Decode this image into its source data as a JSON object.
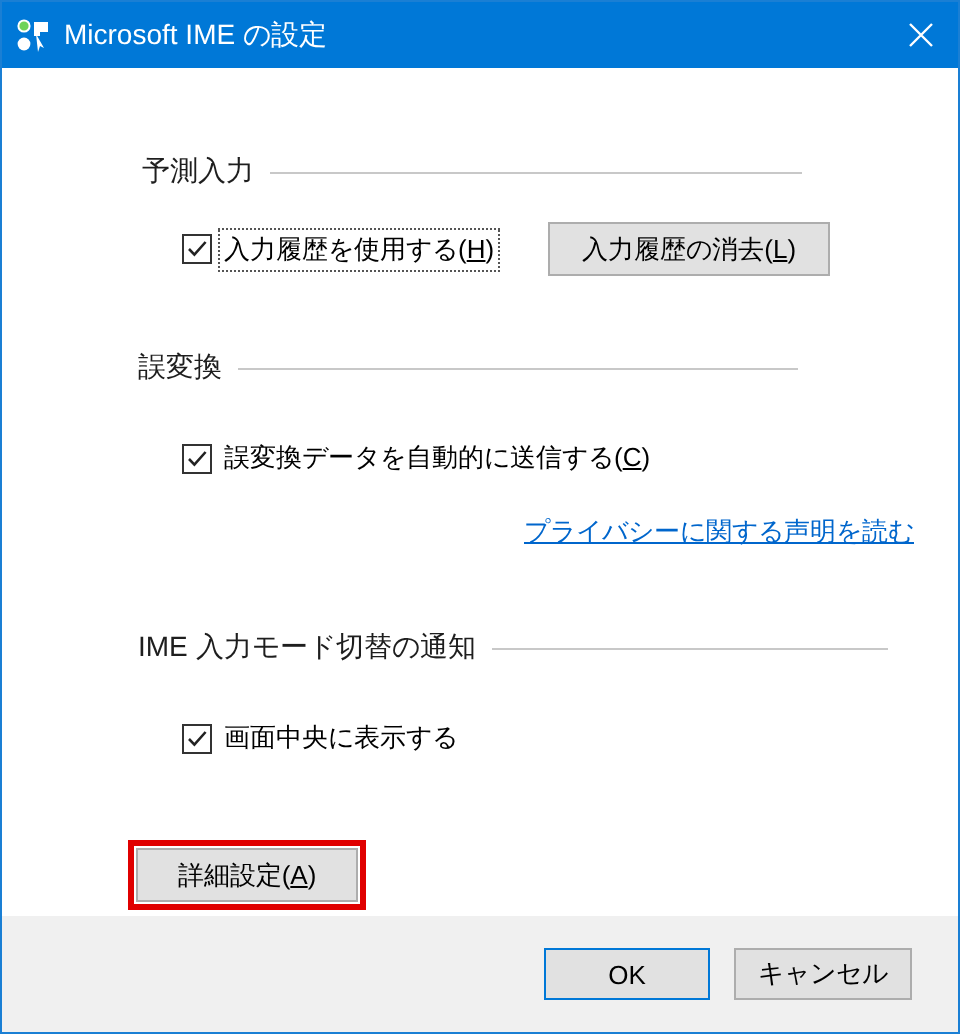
{
  "window": {
    "title": "Microsoft IME の設定"
  },
  "sections": [
    {
      "heading": "予測入力",
      "options": [
        {
          "kind": "checkbox",
          "label": "入力履歴を使用する(",
          "access_key": "H",
          "label_end": ")",
          "checked": true,
          "focused": true,
          "button": {
            "label": "入力履歴の消去(",
            "access_key": "L",
            "label_end": ")"
          }
        }
      ]
    },
    {
      "heading": "誤変換",
      "options": [
        {
          "kind": "checkbox",
          "label": "誤変換データを自動的に送信する(",
          "access_key": "C",
          "label_end": ")",
          "checked": true,
          "focused": false
        },
        {
          "kind": "link",
          "label": "プライバシーに関する声明を読む"
        }
      ]
    },
    {
      "heading": "IME 入力モード切替の通知",
      "options": [
        {
          "kind": "checkbox",
          "label": "画面中央に表示する",
          "checked": true,
          "focused": false
        }
      ]
    }
  ],
  "advanced_button": {
    "label": "詳細設定(",
    "access_key": "A",
    "label_end": ")",
    "highlighted": true
  },
  "buttons": [
    {
      "label": "OK",
      "default": true
    },
    {
      "label": "キャンセル",
      "default": false
    }
  ]
}
